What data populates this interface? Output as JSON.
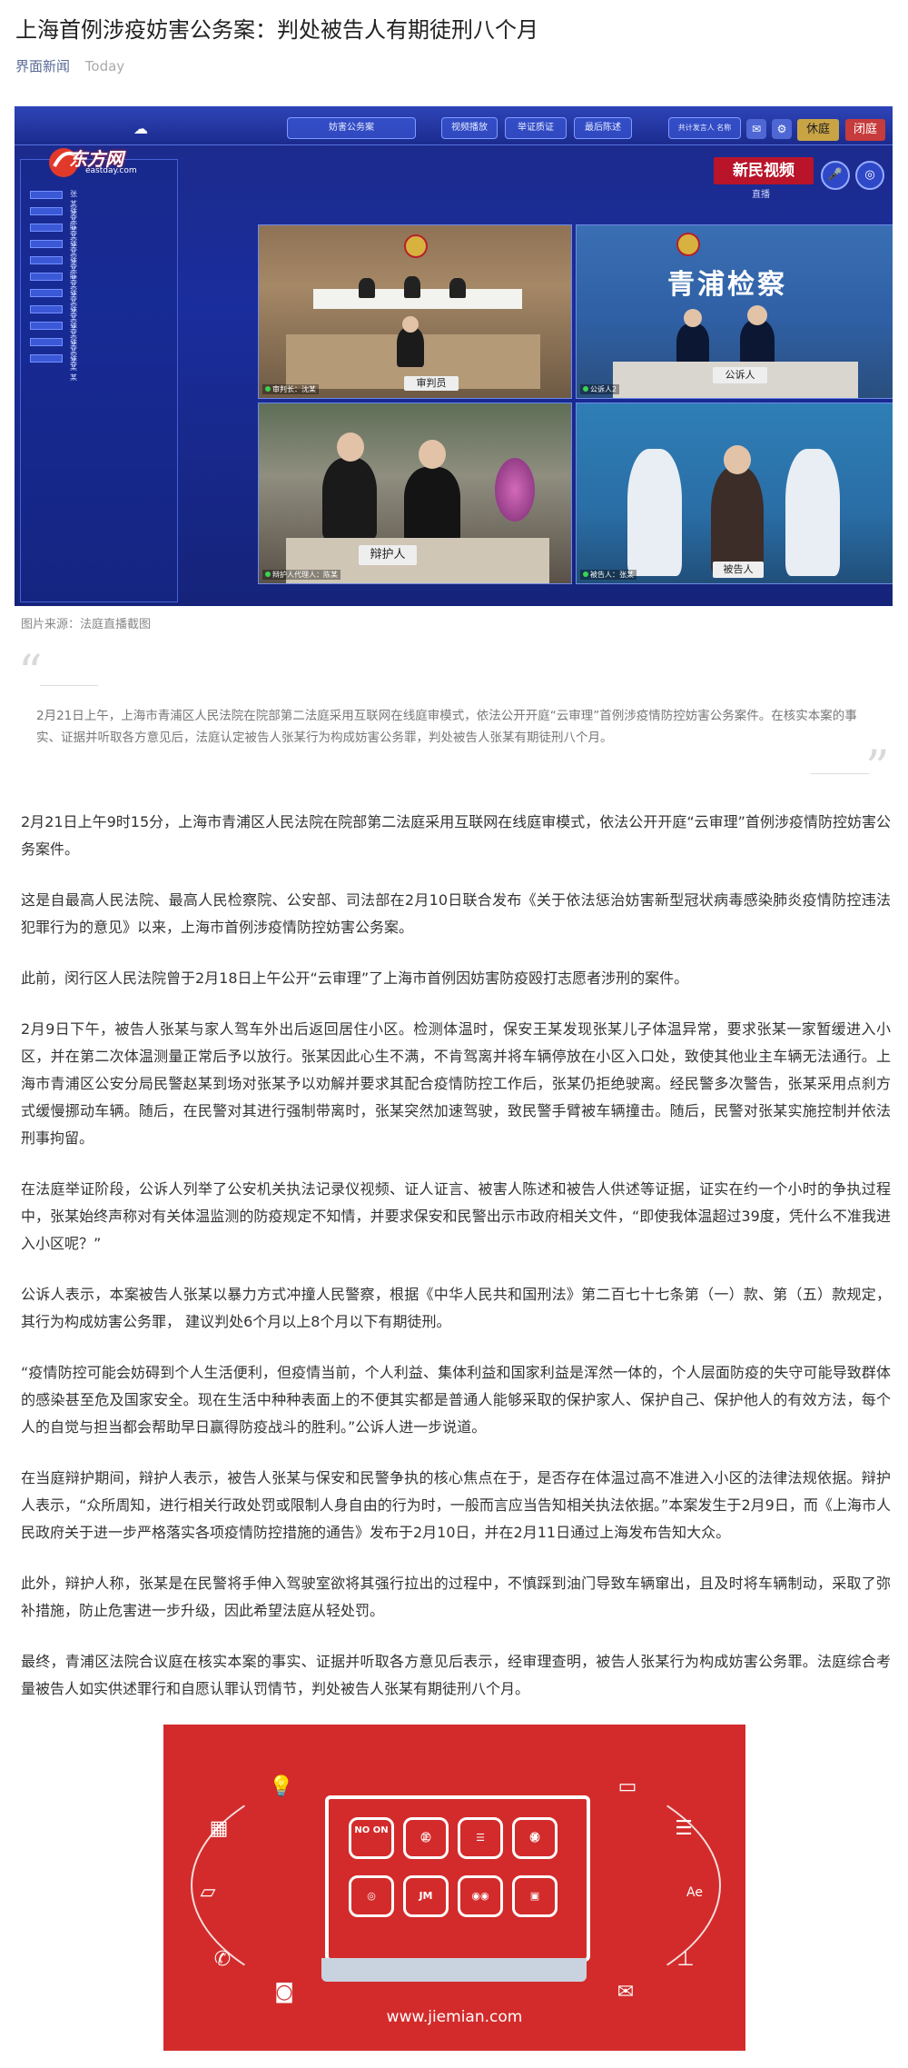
{
  "article": {
    "title": "上海首例涉疫妨害公务案：判处被告人有期徒刑八个月",
    "source": "界面新闻",
    "time": "Today",
    "image_caption": "图片来源：法庭直播截图",
    "summary": "2月21日上午，上海市青浦区人民法院在院部第二法庭采用互联网在线庭审模式，依法公开开庭“云审理”首例涉疫情防控妨害公务案件。在核实本案的事实、证据并听取各方意见后，法庭认定被告人张某行为构成妨害公务罪，判处被告人张某有期徒刑八个月。",
    "paragraphs": [
      "2月21日上午9时15分，上海市青浦区人民法院在院部第二法庭采用互联网在线庭审模式，依法公开开庭“云审理”首例涉疫情防控妨害公务案件。",
      "这是自最高人民法院、最高人民检察院、公安部、司法部在2月10日联合发布《关于依法惩治妨害新型冠状病毒感染肺炎疫情防控违法犯罪行为的意见》以来，上海市首例涉疫情防控妨害公务案。",
      "此前，闵行区人民法院曾于2月18日上午公开“云审理”了上海市首例因妨害防疫殴打志愿者涉刑的案件。",
      "2月9日下午，被告人张某与家人驾车外出后返回居住小区。检测体温时，保安王某发现张某儿子体温异常，要求张某一家暂缓进入小区，并在第二次体温测量正常后予以放行。张某因此心生不满，不肯驾离并将车辆停放在小区入口处，致使其他业主车辆无法通行。上海市青浦区公安分局民警赵某到场对张某予以劝解并要求其配合疫情防控工作后，张某仍拒绝驶离。经民警多次警告，张某采用点刹方式缓慢挪动车辆。随后，在民警对其进行强制带离时，张某突然加速驾驶，致民警手臂被车辆撞击。随后，民警对张某实施控制并依法刑事拘留。",
      "在法庭举证阶段，公诉人列举了公安机关执法记录仪视频、证人证言、被害人陈述和被告人供述等证据，证实在约一个小时的争执过程中，张某始终声称对有关体温监测的防疫规定不知情，并要求保安和民警出示市政府相关文件，“即使我体温超过39度，凭什么不准我进入小区呢？”",
      "公诉人表示，本案被告人张某以暴力方式冲撞人民警察，根据《中华人民共和国刑法》第二百七十七条第（一）款、第（五）款规定，其行为构成妨害公务罪， 建议判处6个月以上8个月以下有期徒刑。",
      "“疫情防控可能会妨碍到个人生活便利，但疫情当前，个人利益、集体利益和国家利益是浑然一体的，个人层面防疫的失守可能导致群体的感染甚至危及国家安全。现在生活中种种表面上的不便其实都是普通人能够采取的保护家人、保护自己、保护他人的有效方法，每个人的自觉与担当都会帮助早日赢得防疫战斗的胜利。”公诉人进一步说道。",
      "在当庭辩护期间，辩护人表示，被告人张某与保安和民警争执的核心焦点在于，是否存在体温过高不准进入小区的法律法规依据。辩护人表示，“众所周知，进行相关行政处罚或限制人身自由的行为时，一般而言应当告知相关执法依据。”本案发生于2月9日，而《上海市人民政府关于进一步严格落实各项疫情防控措施的通告》发布于2月10日，并在2月11日通过上海发布告知大众。",
      "此外，辩护人称，张某是在民警将手伸入驾驶室欲将其强行拉出的过程中，不慎踩到油门导致车辆窜出，且及时将车辆制动，采取了弥补措施，防止危害进一步升级，因此希望法庭从轻处罚。",
      "最终，青浦区法院合议庭在核实本案的事实、证据并听取各方意见后表示，经审理查明，被告人张某行为构成妨害公务罪。法庭综合考量被告人如实供述罪行和自愿认罪认罚情节，判处被告人张某有期徒刑八个月。"
    ]
  },
  "screenshot": {
    "logo": "东方网",
    "logo_sub": "eastday.com",
    "top_pills": [
      "妨害公务案",
      "视频播放",
      "举证质证",
      "最后陈述"
    ],
    "top_info": "共计发言人 名称",
    "btn_rest": "休庭",
    "btn_close": "闭庭",
    "brand": "新民视频",
    "brand_sub": "直播",
    "procuratorate_sign": "青浦检察",
    "sign_prosecutor": "公诉人",
    "sign_defender": "辩护人",
    "sign_defendant": "被告人",
    "panel_labels": [
      "审判长：沈某",
      "公诉人2",
      "辩护人代理人：陈某",
      "被告人：张某"
    ],
    "sidebar_items": [
      "张某某",
      "张某某",
      "陈某某",
      "张某某",
      "张某某",
      "陈某某",
      "张某某",
      "张某某",
      "张某某",
      "张某某",
      "张某某"
    ]
  },
  "banner": {
    "url": "www.jiemian.com",
    "apps": [
      "NO ON",
      "㊣",
      "☰",
      "㊝",
      "◎",
      "JM",
      "◉◉",
      "▣"
    ],
    "icons": [
      "lightbulb-icon",
      "save-icon",
      "building-icon",
      "list-icon",
      "chat-icon",
      "font-icon",
      "phone-icon",
      "signal-icon",
      "camera-icon",
      "mail-icon"
    ],
    "color": "#d32b2b"
  }
}
